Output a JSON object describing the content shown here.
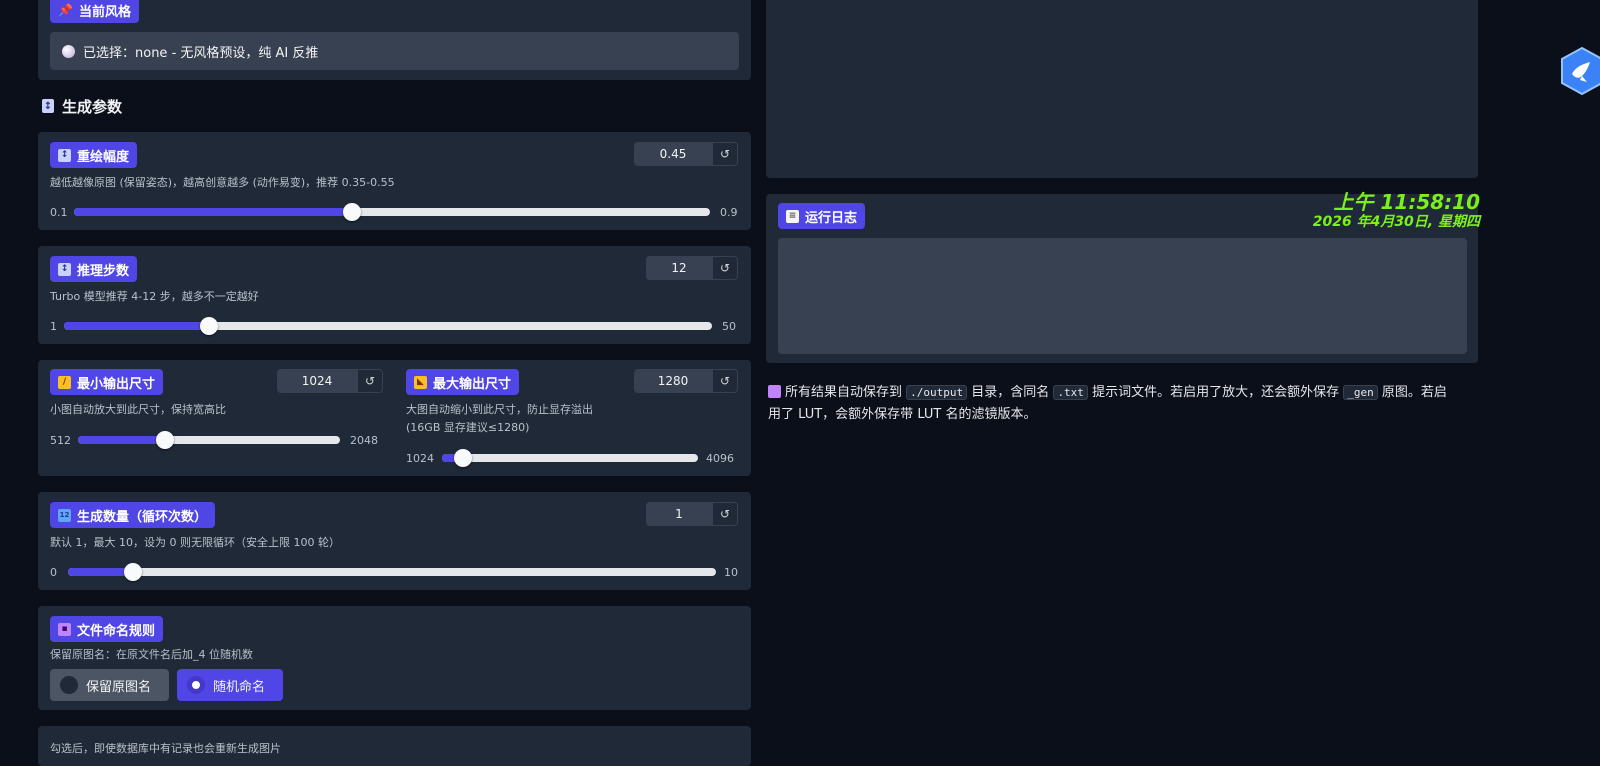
{
  "style_section": {
    "chip": "当前风格",
    "chip_icon": "📌",
    "selected_text": "已选择：none - 无风格预设，纯 AI 反推"
  },
  "gen_params": {
    "title": "生成参数",
    "icon": "↕"
  },
  "denoise": {
    "label": "重绘幅度",
    "value": "0.45",
    "desc": "越低越像原图 (保留姿态)，越高创意越多 (动作易变)，推荐 0.35-0.55",
    "min": "0.1",
    "max": "0.9",
    "level": 0.4375
  },
  "steps": {
    "label": "推理步数",
    "value": "12",
    "desc": "Turbo 模型推荐 4-12 步，越多不一定越好",
    "min": "1",
    "max": "50",
    "level": 0.2245
  },
  "min_size": {
    "label": "最小输出尺寸",
    "value": "1024",
    "desc": "小图自动放大到此尺寸，保持宽高比",
    "min": "512",
    "max": "2048",
    "level": 0.3333
  },
  "max_size": {
    "label": "最大输出尺寸",
    "value": "1280",
    "desc": "大图自动缩小到此尺寸，防止显存溢出",
    "desc2": "(16GB 显存建议≤1280)",
    "min": "1024",
    "max": "4096",
    "level": 0.0833
  },
  "count": {
    "label": "生成数量（循环次数）",
    "value": "1",
    "desc": "默认 1，最大 10，设为 0 则无限循环（安全上限 100 轮）",
    "min": "0",
    "max": "10",
    "level": 0.1
  },
  "naming": {
    "label": "文件命名规则",
    "desc": "保留原图名：在原文件名后加_4 位随机数",
    "options": [
      "保留原图名",
      "随机命名"
    ],
    "selected": "随机命名"
  },
  "bottom_note": "勾选后，即使数据库中有记录也会重新生成图片",
  "reset_glyph": "↺",
  "log": {
    "label": "运行日志"
  },
  "clock": {
    "time": "上午 11:58:10",
    "date": "2026 年4月30日, 星期四"
  },
  "footer": {
    "part1": "所有结果自动保存到",
    "code1": "./output",
    "part2": "目录，含同名",
    "code2": ".txt",
    "part3": "提示词文件。若启用了放大，还会额外保存",
    "code3": "_gen",
    "part4": "原图。若启",
    "line2": "用了 LUT，会额外保存带 LUT 名的滤镜版本。"
  },
  "colors": {
    "accent": "#4f46e5",
    "panel": "#1f2937",
    "background": "#0b0f19",
    "clock": "#7cf01a"
  }
}
